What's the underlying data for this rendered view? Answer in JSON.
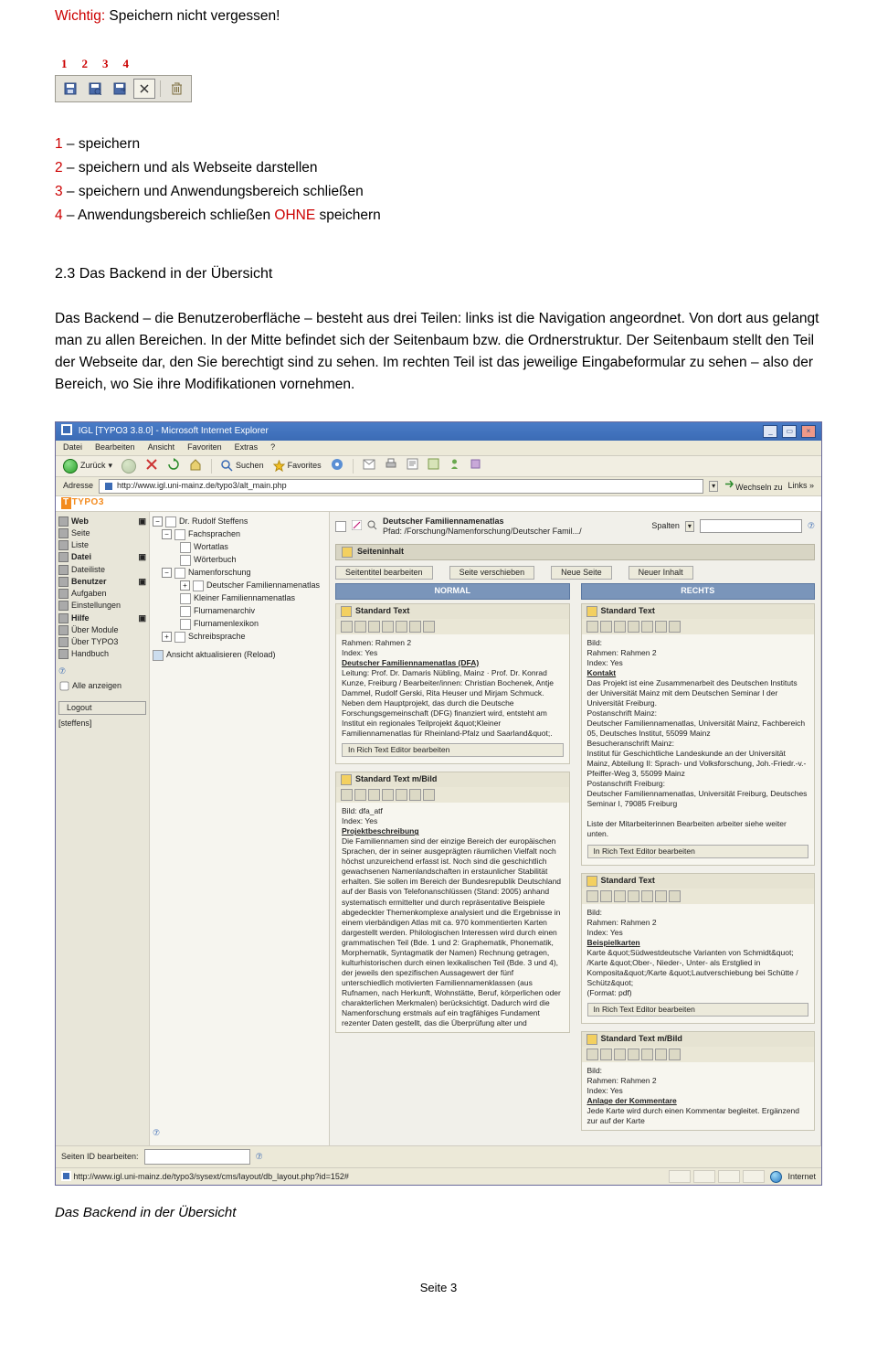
{
  "important": {
    "label": "Wichtig:",
    "text": " Speichern nicht vergessen!"
  },
  "toolbar_numbers": [
    "1",
    "2",
    "3",
    "4"
  ],
  "legend": [
    {
      "n": "1",
      "t": " – speichern"
    },
    {
      "n": "2",
      "t": " – speichern und als Webseite darstellen"
    },
    {
      "n": "3",
      "t": " – speichern und Anwendungsbereich schließen"
    },
    {
      "n": "4",
      "t": " – Anwendungsbereich schließen ",
      "extra": "OHNE",
      "extra_t": " speichern"
    }
  ],
  "section_title": "2.3 Das Backend in der Übersicht",
  "body": "Das Backend – die Benutzeroberfläche – besteht aus drei Teilen: links ist die Navigation angeordnet. Von dort aus gelangt man zu allen Bereichen. In der Mitte befindet sich der Seitenbaum bzw. die Ordnerstruktur. Der Seitenbaum stellt den Teil der Webseite dar, den Sie berechtigt sind zu sehen. Im rechten Teil ist das jeweilige Eingabeformular zu sehen – also der Bereich, wo Sie ihre Modifikationen vornehmen.",
  "shot": {
    "title": "IGL [TYPO3 3.8.0] - Microsoft Internet Explorer",
    "menu": [
      "Datei",
      "Bearbeiten",
      "Ansicht",
      "Favoriten",
      "Extras",
      "?"
    ],
    "nav": {
      "back": "Zurück",
      "search": "Suchen",
      "fav": "Favorites"
    },
    "addr": {
      "label": "Adresse",
      "url": "http://www.igl.uni-mainz.de/typo3/alt_main.php",
      "go": "Wechseln zu",
      "links": "Links"
    },
    "logo": "TYPO3",
    "sidebar": {
      "g1": "Web",
      "g1_items": [
        "Seite",
        "Liste"
      ],
      "g2": "Datei",
      "g2_items": [
        "Dateiliste"
      ],
      "g3": "Benutzer",
      "g3_items": [
        "Aufgaben",
        "Einstellungen"
      ],
      "g4": "Hilfe",
      "g4_items": [
        "Über Module",
        "Über TYPO3",
        "Handbuch"
      ],
      "show_all": "Alle anzeigen",
      "logout": "Logout",
      "user": "[steffens]"
    },
    "tree": {
      "root": "Dr. Rudolf Steffens",
      "n1": "Fachsprachen",
      "n1a": "Wortatlas",
      "n1b": "Wörterbuch",
      "n2": "Namenforschung",
      "n2a": "Deutscher Familiennamenatlas",
      "n2b": "Kleiner Familiennamenatlas",
      "n2c": "Flurnamenarchiv",
      "n2d": "Flurnamenlexikon",
      "n3": "Schreibsprache",
      "reload": "Ansicht aktualisieren (Reload)"
    },
    "main": {
      "heading": "Deutscher Familiennamenatlas",
      "path_label": "Pfad:",
      "path": "/Forschung/Namenforschung/Deutscher Famil.../",
      "spalten": "Spalten",
      "section": "Seiteninhalt",
      "btns": [
        "Seitentitel bearbeiten",
        "Seite verschieben",
        "Neue Seite",
        "Neuer Inhalt"
      ],
      "col_l": "NORMAL",
      "col_r": "RECHTS",
      "left": [
        {
          "h": "Standard Text",
          "meta": "Rahmen: Rahmen 2\nIndex: Yes",
          "bold": "Deutscher Familiennamenatlas (DFA)",
          "body": "Leitung: Prof. Dr. Damaris Nübling, Mainz · Prof. Dr. Konrad Kunze, Freiburg / Bearbeiter/innen: Christian Bochenek, Antje Dammel, Rudolf Gerski, Rita Heuser und Mirjam Schmuck.\nNeben dem Hauptprojekt, das durch die Deutsche Forschungsgemeinschaft (DFG) finanziert wird, entsteht am Institut ein regionales Teilprojekt &quot;Kleiner Familiennamenatlas für Rheinland-Pfalz und Saarland&quot;.",
          "rte": "In Rich Text Editor bearbeiten"
        },
        {
          "h": "Standard Text m/Bild",
          "meta": "Bild: dfa_atf\nIndex: Yes",
          "bold": "Projektbeschreibung",
          "body": "Die Familiennamen sind der einzige Bereich der europäischen Sprachen, der in seiner ausgeprägten räumlichen Vielfalt noch höchst unzureichend erfasst ist. Noch sind die geschichtlich gewachsenen Namenlandschaften in erstaunlicher Stabilität erhalten. Sie sollen im Bereich der Bundesrepublik Deutschland auf der Basis von Telefonanschlüssen (Stand: 2005) anhand systematisch ermittelter und durch repräsentative Beispiele abgedeckter Themenkomplexe analysiert und die Ergebnisse in einem vierbändigen Atlas mit ca. 970 kommentierten Karten dargestellt werden. Philologischen Interessen wird durch einen grammatischen Teil (Bde. 1 und 2: Graphematik, Phonematik, Morphematik, Syntagmatik der Namen) Rechnung getragen, kulturhistorischen durch einen lexikalischen Teil (Bde. 3 und 4), der jeweils den spezifischen Aussagewert der fünf unterschiedlich motivierten Familiennamenklassen (aus Rufnamen, nach Herkunft, Wohnstätte, Beruf, körperlichen oder charakterlichen Merkmalen) berücksichtigt. Dadurch wird die Namenforschung erstmals auf ein tragfähiges Fundament rezenter Daten gestellt, das die Überprüfung alter und",
          "rte": "In Rich Text Editor bearbeiten"
        }
      ],
      "right": [
        {
          "h": "Standard Text",
          "meta": "Bild:\nRahmen: Rahmen 2\nIndex: Yes",
          "bold": "Kontakt",
          "body": "Das Projekt ist eine Zusammenarbeit des Deutschen Instituts der Universität Mainz mit dem Deutschen Seminar I der Universität Freiburg.\nPostanschrift Mainz:\nDeutscher Familiennamenatlas, Universität Mainz, Fachbereich 05, Deutsches Institut, 55099 Mainz\nBesucheranschrift Mainz:\nInstitut für Geschichtliche Landeskunde an der Universität Mainz, Abteilung II: Sprach- und Volksforschung, Joh.-Friedr.-v.-Pfeiffer-Weg 3, 55099 Mainz\nPostanschrift Freiburg:\nDeutscher Familiennamenatlas, Universität Freiburg, Deutsches Seminar I, 79085 Freiburg\n\nListe der Mitarbeiterinnen Bearbeiten arbeiter siehe weiter unten.",
          "rte": "In Rich Text Editor bearbeiten"
        },
        {
          "h": "Standard Text",
          "meta": "Bild:\nRahmen: Rahmen 2\nIndex: Yes",
          "bold": "Beispielkarten",
          "body": "Karte &quot;Südwestdeutsche Varianten von Schmidt&quot;\n/Karte &quot;Ober-, Nieder-, Unter- als Erstglied in Komposita&quot;/Karte &quot;Lautverschiebung bei Schütte / Schütz&quot;\n(Format: pdf)",
          "rte": "In Rich Text Editor bearbeiten"
        },
        {
          "h": "Standard Text m/Bild",
          "meta": "Bild:\nRahmen: Rahmen 2\nIndex: Yes",
          "bold": "Anlage der Kommentare",
          "body": "Jede Karte wird durch einen Kommentar begleitet. Ergänzend zur auf der Karte",
          "rte": ""
        }
      ]
    },
    "footer": {
      "label": "Seiten ID bearbeiten:"
    },
    "status": {
      "url": "http://www.igl.uni-mainz.de/typo3/sysext/cms/layout/db_layout.php?id=152#",
      "zone": "Internet"
    }
  },
  "caption": "Das Backend in der Übersicht",
  "page_footer": "Seite 3"
}
